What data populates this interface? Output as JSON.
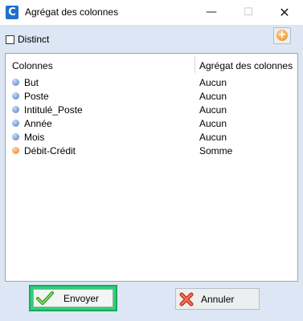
{
  "window": {
    "title": "Agrégat des colonnes",
    "app_icon_letter": "C",
    "controls": {
      "minimize": "—",
      "maximize": "☐",
      "close": "✕"
    }
  },
  "toolbar": {
    "distinct_label": "Distinct",
    "distinct_checked": false,
    "add_icon": "+"
  },
  "table": {
    "headers": [
      "Colonnes",
      "Agrégat des colonnes"
    ],
    "rows": [
      {
        "name": "But",
        "aggregate": "Aucun",
        "icon": "blue"
      },
      {
        "name": "Poste",
        "aggregate": "Aucun",
        "icon": "blue"
      },
      {
        "name": "Intitulé_Poste",
        "aggregate": "Aucun",
        "icon": "blue"
      },
      {
        "name": "Année",
        "aggregate": "Aucun",
        "icon": "blue"
      },
      {
        "name": "Mois",
        "aggregate": "Aucun",
        "icon": "blue"
      },
      {
        "name": "Débit-Crédit",
        "aggregate": "Somme",
        "icon": "orange"
      }
    ]
  },
  "buttons": {
    "send_label": "Envoyer",
    "cancel_label": "Annuler"
  },
  "colors": {
    "background": "#dce6f4",
    "send_highlight": "#2fd07a",
    "blue_dot": "#4d7fc4",
    "orange_dot": "#f07b1a"
  }
}
